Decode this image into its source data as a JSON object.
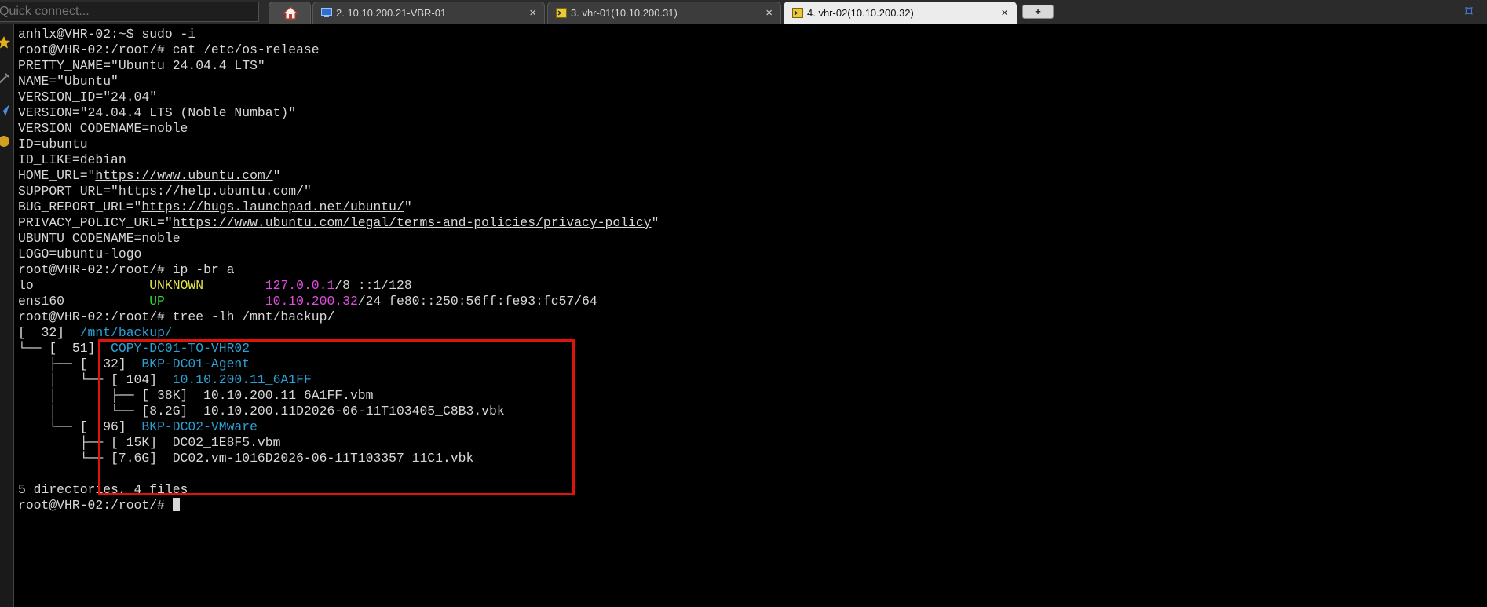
{
  "toolbar": {
    "quick_connect_placeholder": "Quick connect..."
  },
  "tabs": [
    {
      "label": "2. 10.10.200.21-VBR-01",
      "close": "×",
      "icon": "monitor-icon",
      "active": false
    },
    {
      "label": "3. vhr-01(10.10.200.31)",
      "close": "×",
      "icon": "terminal-tab-icon",
      "active": false
    },
    {
      "label": "4. vhr-02(10.10.200.32)",
      "close": "×",
      "icon": "terminal-tab-icon",
      "active": true
    }
  ],
  "new_tab_label": "+",
  "colors": {
    "red_box": "#e0130b",
    "dir_blue": "#2aa1d6",
    "ip_magenta": "#e04ce0",
    "up_green": "#2fd82f",
    "unknown_yellow": "#e2e24a"
  },
  "terminal": {
    "lines": [
      [
        {
          "t": "anhlx@VHR-02:~$ sudo -i"
        }
      ],
      [
        {
          "t": "root@VHR-02:/root/# cat /etc/os-release"
        }
      ],
      [
        {
          "t": "PRETTY_NAME=\"Ubuntu 24.04.4 LTS\""
        }
      ],
      [
        {
          "t": "NAME=\"Ubuntu\""
        }
      ],
      [
        {
          "t": "VERSION_ID=\"24.04\""
        }
      ],
      [
        {
          "t": "VERSION=\"24.04.4 LTS (Noble Numbat)\""
        }
      ],
      [
        {
          "t": "VERSION_CODENAME=noble"
        }
      ],
      [
        {
          "t": "ID=ubuntu"
        }
      ],
      [
        {
          "t": "ID_LIKE=debian"
        }
      ],
      [
        {
          "t": "HOME_URL=\""
        },
        {
          "t": "https://www.ubuntu.com/",
          "c": "u"
        },
        {
          "t": "\""
        }
      ],
      [
        {
          "t": "SUPPORT_URL=\""
        },
        {
          "t": "https://help.ubuntu.com/",
          "c": "u"
        },
        {
          "t": "\""
        }
      ],
      [
        {
          "t": "BUG_REPORT_URL=\""
        },
        {
          "t": "https://bugs.launchpad.net/ubuntu/",
          "c": "u"
        },
        {
          "t": "\""
        }
      ],
      [
        {
          "t": "PRIVACY_POLICY_URL=\""
        },
        {
          "t": "https://www.ubuntu.com/legal/terms-and-policies/privacy-policy",
          "c": "u"
        },
        {
          "t": "\""
        }
      ],
      [
        {
          "t": "UBUNTU_CODENAME=noble"
        }
      ],
      [
        {
          "t": "LOGO=ubuntu-logo"
        }
      ],
      [
        {
          "t": "root@VHR-02:/root/# ip -br a"
        }
      ],
      [
        {
          "t": "lo               "
        },
        {
          "t": "UNKNOWN",
          "c": "c-yel"
        },
        {
          "t": "        "
        },
        {
          "t": "127.0.0.1",
          "c": "c-mag"
        },
        {
          "t": "/8 ::1/128"
        }
      ],
      [
        {
          "t": "ens160           "
        },
        {
          "t": "UP",
          "c": "c-grn"
        },
        {
          "t": "             "
        },
        {
          "t": "10.10.200.32",
          "c": "c-mag"
        },
        {
          "t": "/24 fe80::250:56ff:fe93:fc57/64"
        }
      ],
      [
        {
          "t": "root@VHR-02:/root/# tree -lh /mnt/backup/"
        }
      ],
      [
        {
          "t": "[  32]  "
        },
        {
          "t": "/mnt/backup/",
          "c": "c-blu"
        }
      ],
      [
        {
          "t": "└── [  51]  "
        },
        {
          "t": "COPY-DC01-TO-VHR02",
          "c": "c-blu"
        }
      ],
      [
        {
          "t": "    ├── [  32]  "
        },
        {
          "t": "BKP-DC01-Agent",
          "c": "c-blu"
        }
      ],
      [
        {
          "t": "    │   └── [ 104]  "
        },
        {
          "t": "10.10.200.11_6A1FF",
          "c": "c-blu"
        }
      ],
      [
        {
          "t": "    │       ├── [ 38K]  10.10.200.11_6A1FF.vbm"
        }
      ],
      [
        {
          "t": "    │       └── [8.2G]  10.10.200.11D2026-06-11T103405_C8B3.vbk"
        }
      ],
      [
        {
          "t": "    └── [  96]  "
        },
        {
          "t": "BKP-DC02-VMware",
          "c": "c-blu"
        }
      ],
      [
        {
          "t": "        ├── [ 15K]  DC02_1E8F5.vbm"
        }
      ],
      [
        {
          "t": "        └── [7.6G]  DC02.vm-1016D2026-06-11T103357_11C1.vbk"
        }
      ],
      [
        {
          "t": ""
        }
      ],
      [
        {
          "t": "5 directories, 4 files"
        }
      ],
      [
        {
          "t": "root@VHR-02:/root/# "
        },
        {
          "cursor": true
        }
      ]
    ]
  }
}
